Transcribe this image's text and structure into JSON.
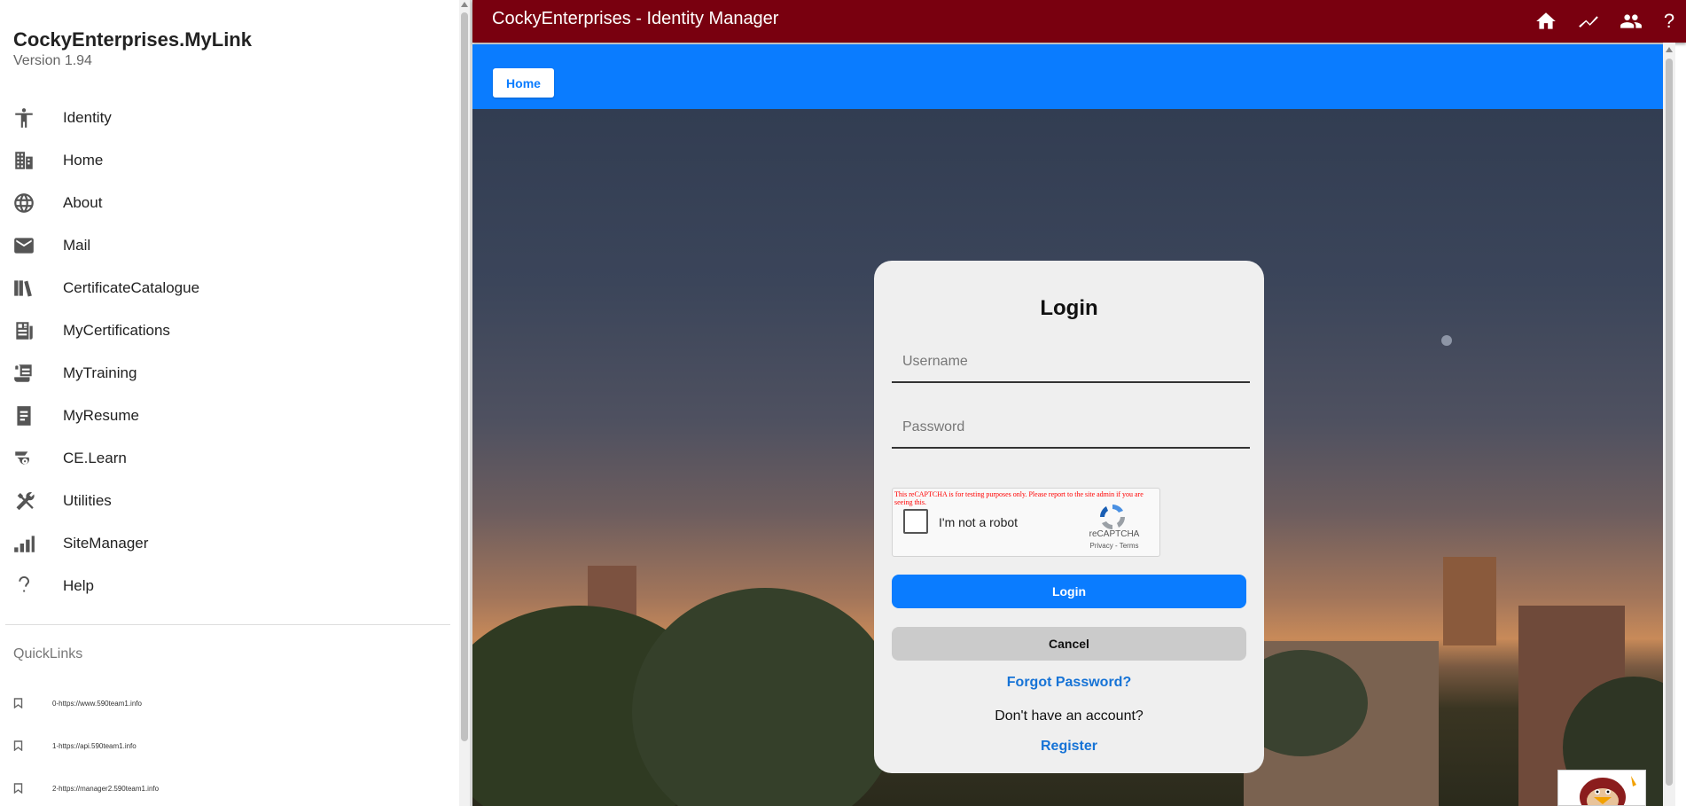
{
  "sidebar": {
    "brand_title": "CockyEnterprises.MyLink",
    "version": "Version 1.94",
    "items": [
      {
        "label": "Identity",
        "icon": "accessibility-icon"
      },
      {
        "label": "Home",
        "icon": "building-icon"
      },
      {
        "label": "About",
        "icon": "globe-icon"
      },
      {
        "label": "Mail",
        "icon": "mail-icon"
      },
      {
        "label": "CertificateCatalogue",
        "icon": "library-icon"
      },
      {
        "label": "MyCertifications",
        "icon": "newspaper-icon"
      },
      {
        "label": "MyTraining",
        "icon": "scroll-icon"
      },
      {
        "label": "MyResume",
        "icon": "document-icon"
      },
      {
        "label": "CE.Learn",
        "icon": "learn-icon"
      },
      {
        "label": "Utilities",
        "icon": "tools-icon"
      },
      {
        "label": "SiteManager",
        "icon": "bar-chart-icon"
      },
      {
        "label": "Help",
        "icon": "help-icon"
      }
    ],
    "quicklinks_title": "QuickLinks",
    "quicklinks": [
      "0-https://www.590team1.info",
      "1-https://api.590team1.info",
      "2-https://manager2.590team1.info"
    ]
  },
  "header": {
    "title": "CockyEnterprises - Identity Manager",
    "icons": [
      "home-icon",
      "trending-icon",
      "people-icon",
      "help-icon"
    ],
    "help_glyph": "?",
    "color": "#79000f"
  },
  "navband": {
    "home_label": "Home",
    "color": "#0a7cff"
  },
  "login": {
    "title": "Login",
    "username_placeholder": "Username",
    "password_placeholder": "Password",
    "recaptcha_warning": "This reCAPTCHA is for testing purposes only. Please report to the site admin if you are seeing this.",
    "recaptcha_label": "I'm not a robot",
    "recaptcha_brand": "reCAPTCHA",
    "recaptcha_links": "Privacy - Terms",
    "login_button": "Login",
    "cancel_button": "Cancel",
    "forgot_password": "Forgot Password?",
    "no_account": "Don't have an account?",
    "register": "Register"
  }
}
